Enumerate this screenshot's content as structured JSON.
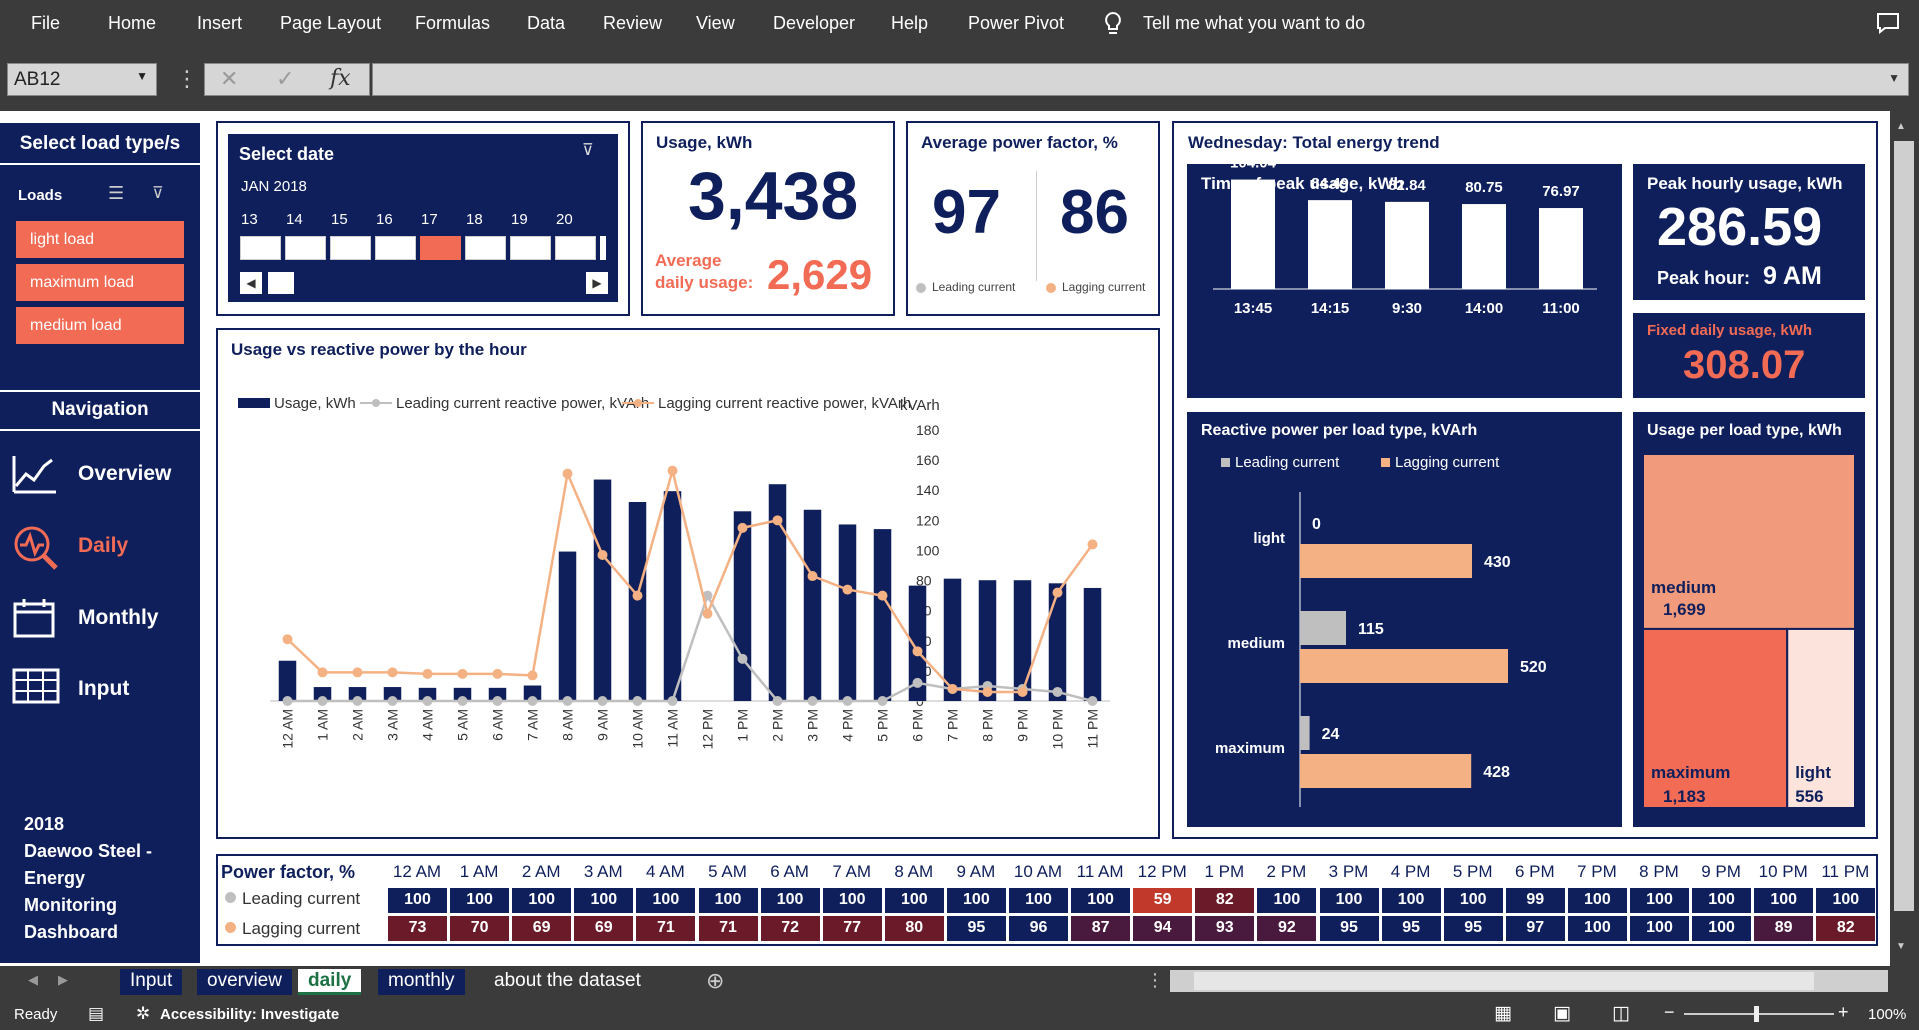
{
  "ribbon": {
    "tabs": [
      "File",
      "Home",
      "Insert",
      "Page Layout",
      "Formulas",
      "Data",
      "Review",
      "View",
      "Developer",
      "Help",
      "Power Pivot"
    ],
    "tell_me": "Tell me what you want to do"
  },
  "formula_bar": {
    "name_box": "AB12",
    "fx_label": "fx",
    "value": ""
  },
  "sidebar": {
    "slicer_title": "Select load type/s",
    "loads_label": "Loads",
    "load_items": [
      "light load",
      "maximum load",
      "medium load"
    ],
    "nav_title": "Navigation",
    "nav_items": [
      "Overview",
      "Daily",
      "Monthly",
      "Input"
    ],
    "active_nav": "Daily",
    "footer_lines": [
      "2018",
      "Daewoo Steel -",
      "Energy",
      "Monitoring",
      "Dashboard"
    ]
  },
  "date_slicer": {
    "title": "Select date",
    "month": "JAN 2018",
    "days": [
      "13",
      "14",
      "15",
      "16",
      "17",
      "18",
      "19",
      "20"
    ],
    "selected_day": "17"
  },
  "usage_card": {
    "title": "Usage, kWh",
    "value": "3,438",
    "avg_label_line1": "Average",
    "avg_label_line2": "daily usage:",
    "avg_value": "2,629"
  },
  "power_factor_card": {
    "title": "Average power factor, %",
    "leading_value": "97",
    "lagging_value": "86",
    "leading_label": "Leading current",
    "lagging_label": "Lagging current"
  },
  "trend_panel": {
    "title": "Wednesday: Total energy trend"
  },
  "peak_time_card": {
    "title": "Time of peak usage, kWh",
    "values": [
      "104.04",
      "84.49",
      "82.84",
      "80.75",
      "76.97"
    ],
    "times": [
      "13:45",
      "14:15",
      "9:30",
      "14:00",
      "11:00"
    ]
  },
  "peak_hourly_card": {
    "title": "Peak hourly usage, kWh",
    "value": "286.59",
    "peak_hour_label": "Peak hour:",
    "peak_hour_value": "9 AM"
  },
  "fixed_usage_card": {
    "title": "Fixed daily usage, kWh",
    "value": "308.07"
  },
  "reactive_card": {
    "title": "Reactive power per load type, kVArh",
    "legend_leading": "Leading current",
    "legend_lagging": "Lagging current",
    "categories": [
      "light",
      "medium",
      "maximum"
    ],
    "leading": [
      "0",
      "115",
      "24"
    ],
    "lagging": [
      "430",
      "520",
      "428"
    ]
  },
  "treemap_card": {
    "title": "Usage per load type, kWh",
    "items": [
      {
        "label": "medium",
        "value": "1,699"
      },
      {
        "label": "maximum",
        "value": "1,183"
      },
      {
        "label": "light",
        "value": "556"
      }
    ]
  },
  "colors": {
    "navy": "#0f1f5c",
    "coral": "#f26b55",
    "peach": "#f4b183",
    "grey": "#bfbfbf"
  },
  "chart_data": {
    "type": "bar",
    "title": "Usage vs reactive power by the hour",
    "ylabel": "kWh",
    "y2label": "kVArh",
    "ylim": [
      0,
      350
    ],
    "y2lim": [
      0,
      180
    ],
    "yticks": [
      "350",
      "300",
      "250",
      "200",
      "150",
      "100",
      "50",
      "0"
    ],
    "y2ticks": [
      "180",
      "160",
      "140",
      "120",
      "100",
      "80",
      "60",
      "40",
      "20",
      "0"
    ],
    "categories": [
      "12 AM",
      "1 AM",
      "2 AM",
      "3 AM",
      "4 AM",
      "5 AM",
      "6 AM",
      "7 AM",
      "8 AM",
      "9 AM",
      "10 AM",
      "11 AM",
      "12 PM",
      "1 PM",
      "2 PM",
      "3 PM",
      "4 PM",
      "5 PM",
      "6 PM",
      "7 PM",
      "8 PM",
      "9 PM",
      "10 PM",
      "11 PM"
    ],
    "series": [
      {
        "name": "Usage, kWh",
        "axis": "left",
        "values": [
          52,
          18,
          18,
          18,
          17,
          17,
          17,
          20,
          193,
          286,
          257,
          271,
          0,
          245,
          280,
          247,
          228,
          222,
          149,
          158,
          156,
          156,
          152,
          146
        ]
      },
      {
        "name": "Leading current reactive power, kVArh",
        "axis": "right",
        "values": [
          0,
          0,
          0,
          0,
          0,
          0,
          0,
          0,
          0,
          0,
          0,
          0,
          70,
          28,
          0,
          0,
          0,
          0,
          12,
          8,
          10,
          8,
          6,
          0
        ]
      },
      {
        "name": "Lagging current reactive power, kVArh",
        "axis": "right",
        "values": [
          41,
          19,
          19,
          19,
          18,
          18,
          18,
          17,
          151,
          97,
          70,
          153,
          58,
          115,
          120,
          83,
          74,
          70,
          33,
          8,
          6,
          6,
          72,
          104
        ]
      }
    ]
  },
  "pf_table": {
    "title": "Power factor, %",
    "hours": [
      "12 AM",
      "1 AM",
      "2 AM",
      "3 AM",
      "4 AM",
      "5 AM",
      "6 AM",
      "7 AM",
      "8 AM",
      "9 AM",
      "10 AM",
      "11 AM",
      "12 PM",
      "1 PM",
      "2 PM",
      "3 PM",
      "4 PM",
      "5 PM",
      "6 PM",
      "7 PM",
      "8 PM",
      "9 PM",
      "10 PM",
      "11 PM"
    ],
    "leading_label": "Leading current",
    "lagging_label": "Lagging current",
    "leading": [
      "100",
      "100",
      "100",
      "100",
      "100",
      "100",
      "100",
      "100",
      "100",
      "100",
      "100",
      "100",
      "59",
      "82",
      "100",
      "100",
      "100",
      "100",
      "99",
      "100",
      "100",
      "100",
      "100",
      "100"
    ],
    "lagging": [
      "73",
      "70",
      "69",
      "69",
      "71",
      "71",
      "72",
      "77",
      "80",
      "95",
      "96",
      "87",
      "94",
      "93",
      "92",
      "95",
      "95",
      "95",
      "97",
      "100",
      "100",
      "100",
      "89",
      "82"
    ]
  },
  "sheet_tabs": [
    "Input",
    "overview",
    "daily",
    "monthly",
    "about the dataset"
  ],
  "active_tab": "daily",
  "status": {
    "ready": "Ready",
    "accessibility": "Accessibility: Investigate",
    "zoom": "100%"
  }
}
